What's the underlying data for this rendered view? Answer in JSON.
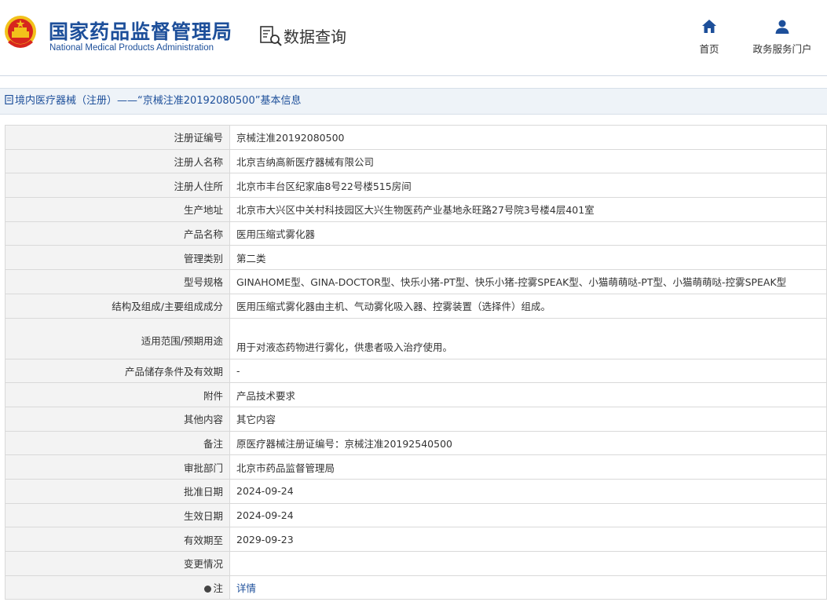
{
  "header": {
    "org_cn": "国家药品监督管理局",
    "org_en": "National Medical Products Administration",
    "section_title": "数据查询",
    "nav": {
      "home": "首页",
      "portal": "政务服务门户"
    }
  },
  "colors": {
    "brand_blue": "#1d4f9a",
    "emblem_red": "#d7261e",
    "emblem_gold": "#f2c21b"
  },
  "breadcrumb": "境内医疗器械（注册）——“京械注准20192080500”基本信息",
  "rows": [
    {
      "label": "注册证编号",
      "value": "京械注准20192080500"
    },
    {
      "label": "注册人名称",
      "value": "北京吉纳高新医疗器械有限公司"
    },
    {
      "label": "注册人住所",
      "value": "北京市丰台区纪家庙8号22号楼515房间"
    },
    {
      "label": "生产地址",
      "value": "北京市大兴区中关村科技园区大兴生物医药产业基地永旺路27号院3号楼4层401室"
    },
    {
      "label": "产品名称",
      "value": "医用压缩式雾化器"
    },
    {
      "label": "管理类别",
      "value": "第二类"
    },
    {
      "label": "型号规格",
      "value": "GINAHOME型、GINA-DOCTOR型、快乐小猪-PT型、快乐小猪-控雾SPEAK型、小猫萌萌哒-PT型、小猫萌萌哒-控雾SPEAK型"
    },
    {
      "label": "结构及组成/主要组成成分",
      "value": "医用压缩式雾化器由主机、气动雾化吸入器、控雾装置（选择件）组成。"
    },
    {
      "label": "适用范围/预期用途",
      "value": "用于对液态药物进行雾化，供患者吸入治疗使用。"
    },
    {
      "label": "产品储存条件及有效期",
      "value": "-"
    },
    {
      "label": "附件",
      "value": "产品技术要求"
    },
    {
      "label": "其他内容",
      "value": "其它内容"
    },
    {
      "label": "备注",
      "value": "原医疗器械注册证编号：京械注准20192540500"
    },
    {
      "label": "审批部门",
      "value": "北京市药品监督管理局"
    },
    {
      "label": "批准日期",
      "value": "2024-09-24"
    },
    {
      "label": "生效日期",
      "value": "2024-09-24"
    },
    {
      "label": "有效期至",
      "value": "2029-09-23"
    },
    {
      "label": "变更情况",
      "value": ""
    },
    {
      "label": "注",
      "value": "详情"
    }
  ]
}
